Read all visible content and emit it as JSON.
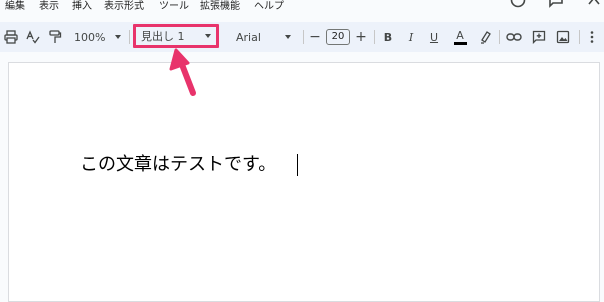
{
  "menu": {
    "items": [
      "編集",
      "表示",
      "挿入",
      "表示形式",
      "ツール",
      "拡張機能",
      "ヘルプ"
    ]
  },
  "toolbar": {
    "zoom": "100%",
    "paragraph_style": "見出し 1",
    "font": "Arial",
    "font_size": "20",
    "minus": "−",
    "plus": "+",
    "bold": "B",
    "italic": "I",
    "underline": "U",
    "text_color": "A"
  },
  "document": {
    "text": "この文章はテストです。"
  },
  "colors": {
    "highlight": "#e8336b",
    "toolbar_bg": "#edf2fa"
  },
  "icons": [
    "print-icon",
    "spellcheck-icon",
    "paint-format-icon",
    "highlighter-icon",
    "link-icon",
    "add-comment-icon",
    "insert-image-icon",
    "more-icon"
  ]
}
